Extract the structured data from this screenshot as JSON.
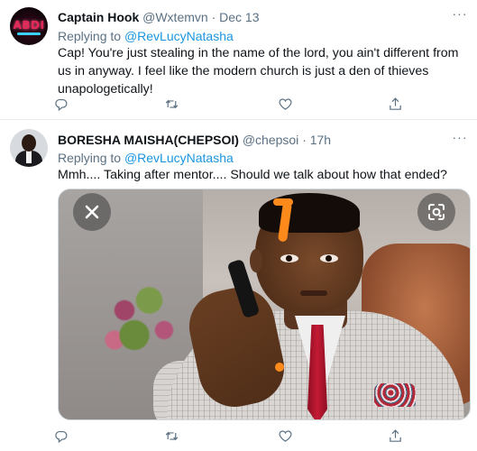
{
  "tweets": [
    {
      "display_name": "Captain Hook",
      "handle": "@Wxtemvn",
      "time": "· Dec 13",
      "replying_label": "Replying to ",
      "replying_to": "@RevLucyNatasha",
      "text": "Cap! You're just stealing in the name of the lord, you ain't different from us in anyway. I feel like the modern church is just a den of thieves unapologetically!",
      "more": "···",
      "avatar_text": "ABDI"
    },
    {
      "display_name": "BORESHA MAISHA(CHEPSOI)",
      "handle": "@chepsoi",
      "time": "· 17h",
      "replying_label": "Replying to ",
      "replying_to": "@RevLucyNatasha",
      "text": "Mmh.... Taking after mentor.... Should we talk about how that ended?",
      "more": "···"
    }
  ],
  "actions": {
    "icons": [
      "reply-icon",
      "retweet-icon",
      "like-icon",
      "share-icon"
    ]
  },
  "colors": {
    "mention": "#1b95e0",
    "meta": "#5b7083",
    "text": "#0f1419",
    "divider": "#e6ecf0",
    "overlay_accent": "#ff8a1c"
  }
}
